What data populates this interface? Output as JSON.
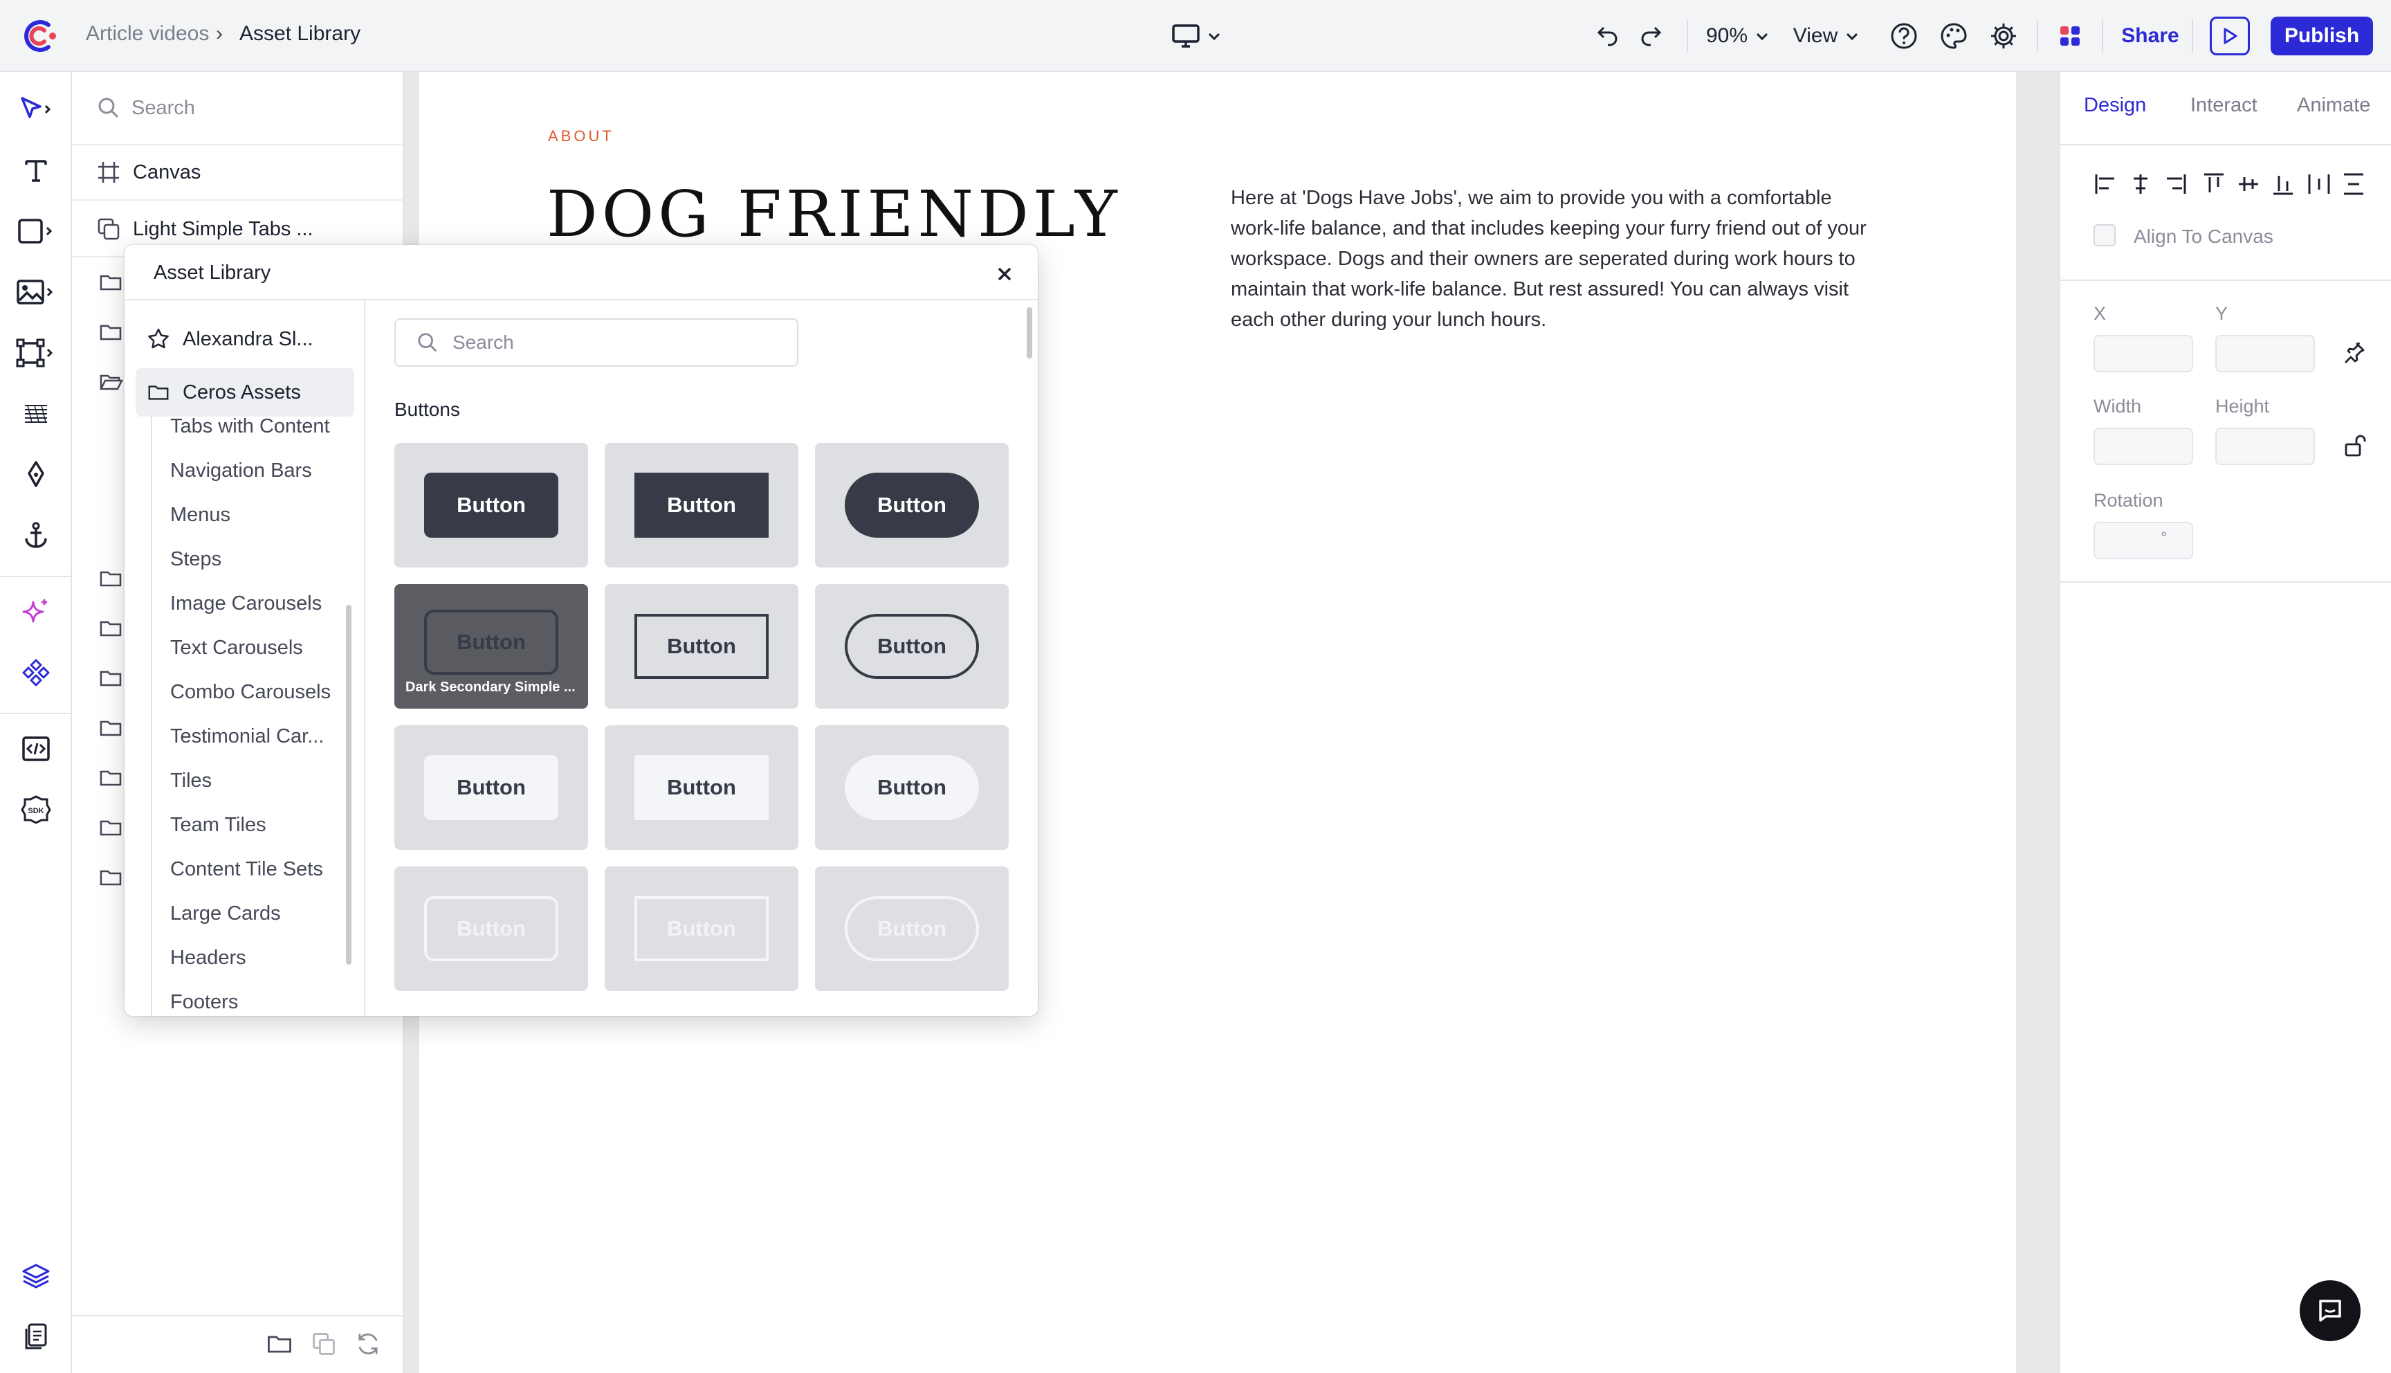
{
  "breadcrumb": {
    "parent": "Article videos",
    "current": "Asset Library"
  },
  "topbar": {
    "zoom": "90%",
    "view": "View",
    "share": "Share",
    "publish": "Publish"
  },
  "layers": {
    "search_placeholder": "Search",
    "canvas": "Canvas",
    "first_item": "Light Simple Tabs ..."
  },
  "canvas": {
    "eyebrow": "ABOUT",
    "heading": "DOG FRIENDLY",
    "body": "Here at 'Dogs Have Jobs', we aim to provide you with a comfortable work-life balance, and that includes keeping your furry friend out of your workspace. Dogs and their owners are seperated during work hours to maintain that work-life balance. But rest assured! You can always visit each other during your lunch hours."
  },
  "right_panel": {
    "tabs": [
      "Design",
      "Interact",
      "Animate"
    ],
    "align_to_canvas": "Align To Canvas",
    "x": "X",
    "y": "Y",
    "width": "Width",
    "height": "Height",
    "rotation": "Rotation",
    "degree": "°"
  },
  "modal": {
    "title": "Asset Library",
    "search_placeholder": "Search",
    "section": "Buttons",
    "sidebar_user": "Alexandra Sl...",
    "sidebar_root": "Ceros Assets",
    "categories": [
      "Tabs with Content",
      "Navigation Bars",
      "Menus",
      "Steps",
      "Image Carousels",
      "Text Carousels",
      "Combo Carousels",
      "Testimonial Car...",
      "Tiles",
      "Team Tiles",
      "Content Tile Sets",
      "Large Cards",
      "Headers",
      "Footers"
    ],
    "button_label": "Button",
    "hover_caption": "Dark Secondary Simple ..."
  },
  "colors": {
    "accent": "#2c2ad6",
    "eyebrow": "#e0592a",
    "dark_button": "#363b47"
  }
}
